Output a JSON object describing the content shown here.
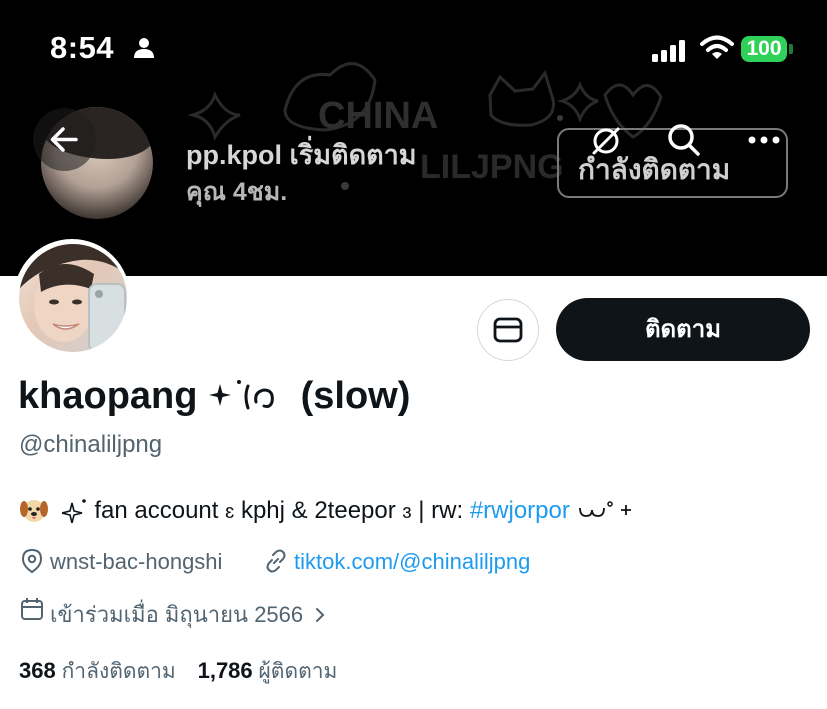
{
  "status_bar": {
    "time": "8:54",
    "battery": "100"
  },
  "banner": {
    "notification": {
      "username": "pp.kpol",
      "action": "เริ่มติดตาม",
      "target": "คุณ",
      "age": "4ชม."
    },
    "following_button_label": "กำลังติดตาม",
    "watermark_text": "CHINA",
    "watermark_text2": "LILJPNG"
  },
  "profile": {
    "display_name": "khaopang",
    "display_name_suffix": "(slow)",
    "handle": "@chinaliljpng",
    "bio_text": "fan account",
    "bio_mid": "kphj & 2teepor",
    "bio_rw": "| rw:",
    "bio_tag": "#rwjorpor",
    "location": "wnst-bac-hongshi",
    "website": "tiktok.com/@chinaliljpng",
    "joined": "เข้าร่วมเมื่อ มิถุนายน 2566",
    "following_count": "368",
    "following_label": "กำลังติดตาม",
    "followers_count": "1,786",
    "followers_label": "ผู้ติดตาม"
  },
  "actions": {
    "follow_label": "ติดตาม"
  },
  "colors": {
    "accent": "#1d9bf0",
    "primary_text": "#0f1419",
    "secondary_text": "#536471",
    "battery": "#30d158"
  }
}
